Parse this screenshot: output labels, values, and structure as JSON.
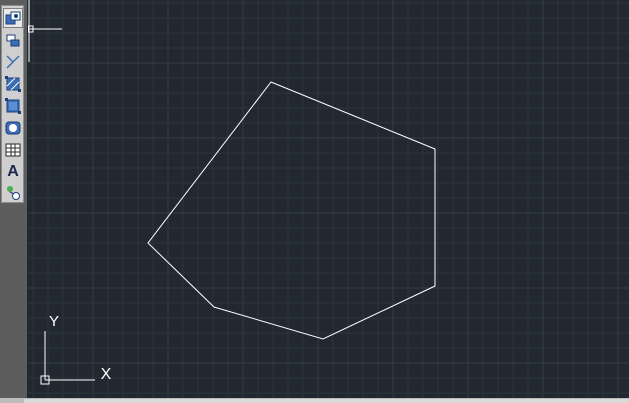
{
  "toolbar": {
    "tools": [
      {
        "name": "insert-block-icon",
        "active": true
      },
      {
        "name": "make-block-icon",
        "active": false
      },
      {
        "name": "point-icon",
        "active": false
      },
      {
        "name": "hatch-icon",
        "active": false
      },
      {
        "name": "gradient-icon",
        "active": false
      },
      {
        "name": "region-icon",
        "active": false
      },
      {
        "name": "table-icon",
        "active": false
      },
      {
        "name": "multiline-text-icon",
        "active": false,
        "glyph": "A"
      },
      {
        "name": "add-selected-icon",
        "active": false
      }
    ]
  },
  "canvas": {
    "background": "#212830",
    "grid_minor_color": "#2b333d",
    "grid_major_color": "#343d48",
    "drawing_color": "#ffffff",
    "drawn_objects": [
      "polygon"
    ]
  },
  "ucs_icon": {
    "x_label": "X",
    "y_label": "Y"
  }
}
